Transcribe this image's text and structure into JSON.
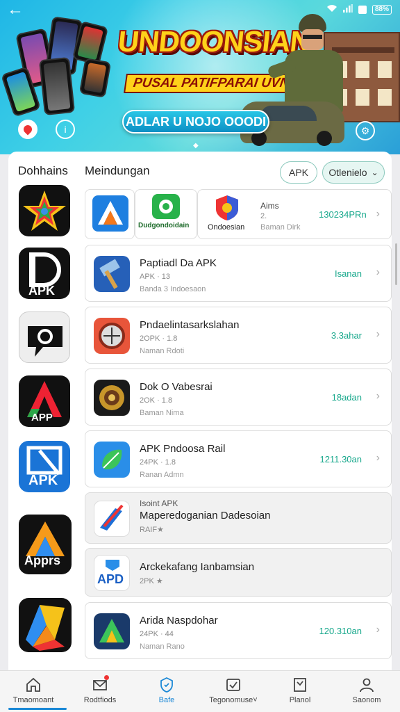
{
  "status_bar": {
    "battery": "88%"
  },
  "banner": {
    "title": "UNDOONSIAN",
    "subtitle": "PUSAL PATIFPARAI UVNA",
    "cta": "ADLAR U NOJO OOODI"
  },
  "section": {
    "tab_left": "Dohhains",
    "tab_right": "Meindungan",
    "apk_pill": "APK",
    "filter_pill": "Otlenielo"
  },
  "row1": {
    "icon_b_label": "Dudgondoidain",
    "icon_c_label": "Ondoesian",
    "name": "Aims",
    "meta": "2.",
    "dev": "Baman Dirk",
    "size": "130234PRn"
  },
  "apps": [
    {
      "name": "Paptiadl Da APK",
      "meta": "APK · 13",
      "dev": "Banda 3 Indoesaon",
      "size": "Isanan"
    },
    {
      "name": "Pndaelintasarkslahan",
      "meta": "2OPK · 1.8",
      "dev": "Naman Rdoti",
      "size": "3.3ahar"
    },
    {
      "name": "Dok O Vabesrai",
      "meta": "2OK · 1.8",
      "dev": "Baman Nima",
      "size": "18adan"
    },
    {
      "name": "APK Pndoosa Rail",
      "meta": "24PK · 1.8",
      "dev": "Ranan Admn",
      "size": "1211.30an"
    },
    {
      "name": "Maperedoganian Dadesoian",
      "top": "Isoint APK",
      "meta": "RAIF★",
      "size": ""
    },
    {
      "name": "Arckekafang Ianbamsian",
      "meta": "2PK ★",
      "size": ""
    },
    {
      "name": "Arida Naspdohar",
      "meta": "24PK · 44",
      "dev": "Naman Rano",
      "size": "120.310an"
    }
  ],
  "left_icons": [
    {
      "name": "star-logo",
      "label": ""
    },
    {
      "name": "d-apk-logo",
      "label": "APK"
    },
    {
      "name": "chat-logo",
      "label": ""
    },
    {
      "name": "a-apk-logo",
      "label": "APP"
    },
    {
      "name": "apk-box-logo",
      "label": "APK"
    },
    {
      "name": "apprs-logo",
      "label": "Apprs"
    },
    {
      "name": "colorful-logo",
      "label": ""
    }
  ],
  "nav": [
    {
      "label": "Tmaomoant",
      "icon": "home-icon"
    },
    {
      "label": "Rodtfiods",
      "icon": "mail-icon"
    },
    {
      "label": "Bafe",
      "icon": "shield-icon"
    },
    {
      "label": "Tegonomuse˅",
      "icon": "checkmark-icon"
    },
    {
      "label": "Planol",
      "icon": "planner-icon"
    },
    {
      "label": "Saonom",
      "icon": "profile-icon"
    }
  ]
}
